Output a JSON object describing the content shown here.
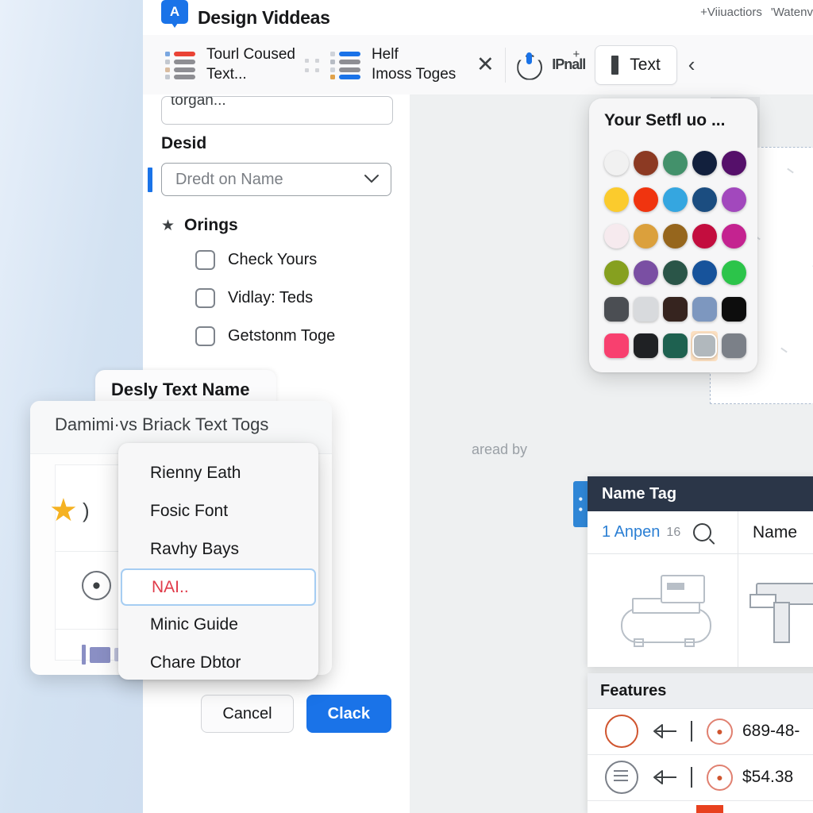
{
  "window": {
    "app_initial": "A",
    "title": "Design Viddeas",
    "right_text_1": "+Viiuactiors",
    "right_text_2": "'Watenv"
  },
  "toolbar": {
    "items": [
      {
        "label_line1": "Tourl Coused",
        "label_line2": "Text...",
        "icon": "list-red-icon"
      },
      {
        "label_line1": "Helf",
        "label_line2": "Imoss Toges",
        "icon": "list-blue-icon"
      }
    ],
    "close_icon": "close-icon",
    "power_icon": "power-icon",
    "ipn_label": "IPnall",
    "ipn_plus": "+",
    "text_button": "Text",
    "chevron": "‹"
  },
  "form": {
    "top_field_value": "torgan...",
    "desid_label": "Desid",
    "select_placeholder": "Dredt on Name",
    "select_chevron": "⌄",
    "group_star": "★",
    "group_label": "Orings",
    "checkboxes": [
      {
        "label": "Check Yours",
        "checked": false
      },
      {
        "label": "Vidlay: Teds",
        "checked": false
      },
      {
        "label": "Getstonm Toge",
        "checked": false
      }
    ],
    "cancel_label": "Cancel",
    "confirm_label": "Clack"
  },
  "canvas": {
    "hint": "aread by"
  },
  "palette": {
    "title": "Your Setfl uo ...",
    "swatches": [
      {
        "color": "#f1f1f1",
        "shape": "round",
        "selected": false
      },
      {
        "color": "#8c3a23",
        "shape": "round",
        "selected": false
      },
      {
        "color": "#43916b",
        "shape": "round",
        "selected": false
      },
      {
        "color": "#12203d",
        "shape": "round",
        "selected": false
      },
      {
        "color": "#55106a",
        "shape": "round",
        "selected": false
      },
      {
        "color": "#fbcb2d",
        "shape": "round",
        "selected": false
      },
      {
        "color": "#f0340f",
        "shape": "round",
        "selected": false
      },
      {
        "color": "#35a6e0",
        "shape": "round",
        "selected": false
      },
      {
        "color": "#1b4d80",
        "shape": "round",
        "selected": false
      },
      {
        "color": "#a248bd",
        "shape": "round",
        "selected": false
      },
      {
        "color": "#f6eaee",
        "shape": "round",
        "selected": false
      },
      {
        "color": "#dba03c",
        "shape": "round",
        "selected": false
      },
      {
        "color": "#96661d",
        "shape": "round",
        "selected": false
      },
      {
        "color": "#c30d3e",
        "shape": "round",
        "selected": false
      },
      {
        "color": "#c42390",
        "shape": "round",
        "selected": false
      },
      {
        "color": "#86a01f",
        "shape": "round",
        "selected": false
      },
      {
        "color": "#7a4fa3",
        "shape": "round",
        "selected": false
      },
      {
        "color": "#2a5548",
        "shape": "round",
        "selected": false
      },
      {
        "color": "#17539b",
        "shape": "round",
        "selected": false
      },
      {
        "color": "#2cc44a",
        "shape": "round",
        "selected": false
      },
      {
        "color": "#4b4e53",
        "shape": "sq",
        "selected": false
      },
      {
        "color": "#d8dadd",
        "shape": "sq",
        "selected": false
      },
      {
        "color": "#36241f",
        "shape": "sq",
        "selected": false
      },
      {
        "color": "#7d97bf",
        "shape": "sq",
        "selected": false
      },
      {
        "color": "#0d0d0d",
        "shape": "sq",
        "selected": false
      },
      {
        "color": "#f8406f",
        "shape": "sq",
        "selected": false
      },
      {
        "color": "#1f2124",
        "shape": "sq",
        "selected": false
      },
      {
        "color": "#1e6150",
        "shape": "sq",
        "selected": false
      },
      {
        "color": "#b1b8bd",
        "shape": "sq",
        "selected": true
      },
      {
        "color": "#7b8088",
        "shape": "sq",
        "selected": false
      }
    ]
  },
  "dialog": {
    "back_title": "Desly Text Name",
    "card_title": "Damimi·vs Briack Text Togs",
    "star_icon": "star-icon",
    "star_paren": ")",
    "badge_icon": "avatar-badge-icon",
    "flag_icon": "flag-icon"
  },
  "dropdown": {
    "items": [
      {
        "label": "Rienny Eath",
        "selected": false
      },
      {
        "label": "Fosic Font",
        "selected": false
      },
      {
        "label": "Ravhy Bays",
        "selected": false
      },
      {
        "label": "NAI..",
        "selected": true
      },
      {
        "label": "Minic Guide",
        "selected": false
      },
      {
        "label": "Chare Dbtor",
        "selected": false
      }
    ]
  },
  "name_tag_panel": {
    "title": "Name Tag",
    "tab_blue": "1 Anpen",
    "tab_count": "16",
    "search_icon": "search-icon",
    "tab_plain": "Name",
    "thumb_1": "printer-icon",
    "thumb_2": "roller-icon"
  },
  "features_panel": {
    "title": "Features",
    "rows": [
      {
        "shape_icon": "circle-outline-icon",
        "arrow_icon": "arrow-left-icon",
        "divider": "|",
        "badge_icon": "person-icon",
        "value": "689-48-"
      },
      {
        "shape_icon": "lines-circle-icon",
        "arrow_icon": "arrow-left-icon",
        "divider": "|",
        "badge_icon": "person-icon",
        "value": "$54.38"
      }
    ]
  }
}
